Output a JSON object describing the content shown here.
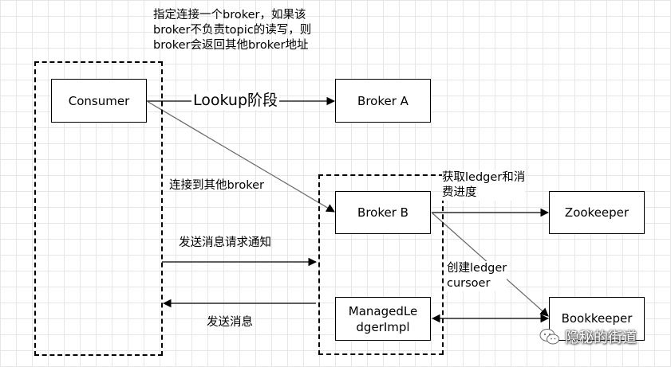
{
  "nodes": {
    "consumer": "Consumer",
    "broker_a": "Broker A",
    "broker_b": "Broker B",
    "zookeeper": "Zookeeper",
    "bookkeeper": "Bookkeeper",
    "managed_ledger": "ManagedLe\ndgerImpl"
  },
  "labels": {
    "note": "指定连接一个broker，如果该\nbroker不负责topic的读写，则\nbroker会返回其他broker地址",
    "lookup": "Lookup阶段",
    "connect_other": "连接到其他broker",
    "send_request": "发送消息请求通知",
    "send_message": "发送消息",
    "get_ledger": "获取ledger和消\n费进度",
    "create_cursor": "创建ledger\ncursoer"
  },
  "watermark": {
    "text": "隐秘的街道"
  },
  "colors": {
    "line": "#000000",
    "diagonal": "#666666",
    "grid": "#e6e6e6"
  }
}
